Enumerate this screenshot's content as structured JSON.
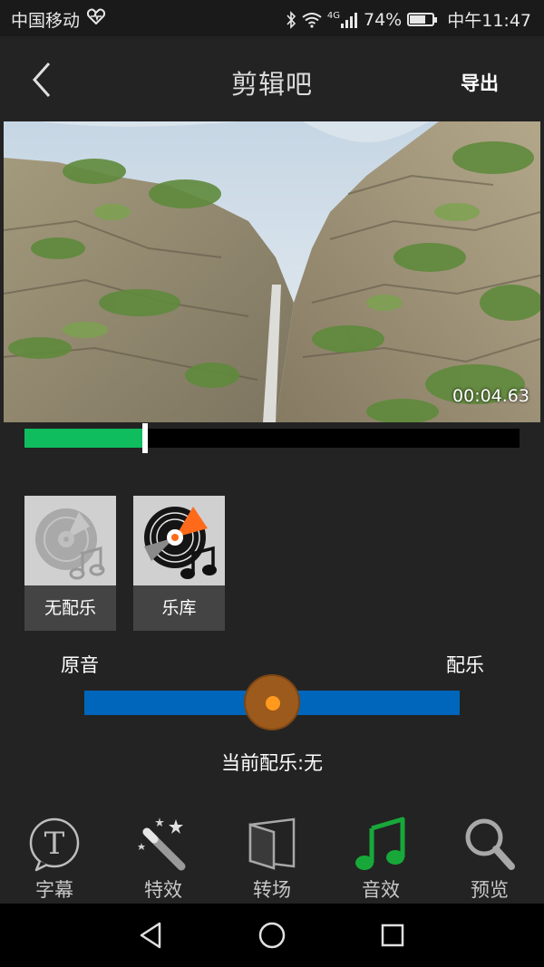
{
  "status_bar": {
    "carrier": "中国移动",
    "network": "4G",
    "battery": "74%",
    "battery_level": 0.74,
    "time": "中午11:47"
  },
  "header": {
    "title": "剪辑吧",
    "export_label": "导出"
  },
  "video": {
    "timecode": "00:04.63",
    "progress": 0.24
  },
  "music_options": [
    {
      "label": "无配乐",
      "icon": "no-music-disc-icon"
    },
    {
      "label": "乐库",
      "icon": "music-library-disc-icon"
    }
  ],
  "mix": {
    "left_label": "原音",
    "right_label": "配乐",
    "value": 0.5,
    "current_label": "当前配乐:无"
  },
  "tabs": [
    {
      "label": "字幕",
      "icon": "subtitle-t-icon",
      "active": false
    },
    {
      "label": "特效",
      "icon": "magic-wand-icon",
      "active": false
    },
    {
      "label": "转场",
      "icon": "transition-icon",
      "active": false
    },
    {
      "label": "音效",
      "icon": "music-note-icon",
      "active": true
    },
    {
      "label": "预览",
      "icon": "magnifier-icon",
      "active": false
    }
  ],
  "colors": {
    "background": "#232323",
    "progress_fill": "#0fbd5f",
    "slider_track": "#0066bb",
    "slider_knob": "#9c5a1c",
    "slider_knob_center": "#ff9a1e",
    "active_tab_icon": "#18a83a"
  },
  "nav": {
    "buttons": [
      "back-triangle-icon",
      "home-circle-icon",
      "recents-square-icon"
    ]
  }
}
